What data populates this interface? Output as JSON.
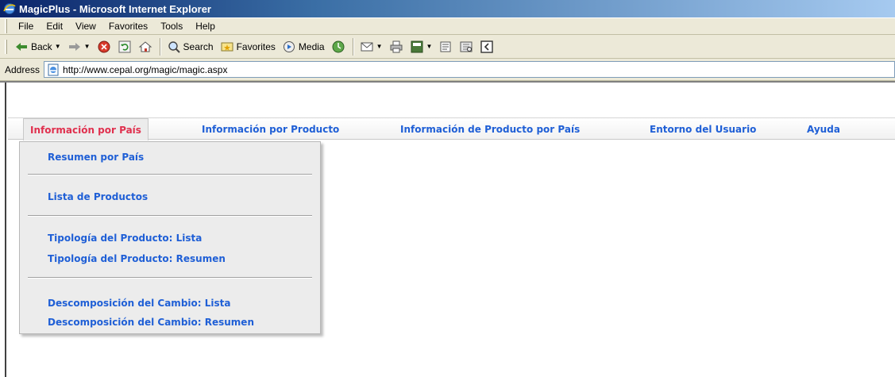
{
  "window": {
    "title": "MagicPlus - Microsoft Internet Explorer"
  },
  "menubar": {
    "items": [
      "File",
      "Edit",
      "View",
      "Favorites",
      "Tools",
      "Help"
    ]
  },
  "toolbar": {
    "back_label": "Back",
    "search_label": "Search",
    "favorites_label": "Favorites",
    "media_label": "Media"
  },
  "address": {
    "label": "Address",
    "url": "http://www.cepal.org/magic/magic.aspx"
  },
  "nav": {
    "items": [
      "Información por País",
      "Información por Producto",
      "Información de Producto por País",
      "Entorno del Usuario",
      "Ayuda"
    ],
    "active_index": 0
  },
  "dropdown": {
    "items": [
      "Resumen por País",
      "Lista de Productos",
      "Tipología del Producto: Lista",
      "Tipología del Producto: Resumen",
      "Descomposición del Cambio: Lista",
      "Descomposición del Cambio: Resumen"
    ]
  },
  "colors": {
    "link": "#1f5fd6",
    "active_link": "#e0304e",
    "chrome": "#ece9d8"
  }
}
